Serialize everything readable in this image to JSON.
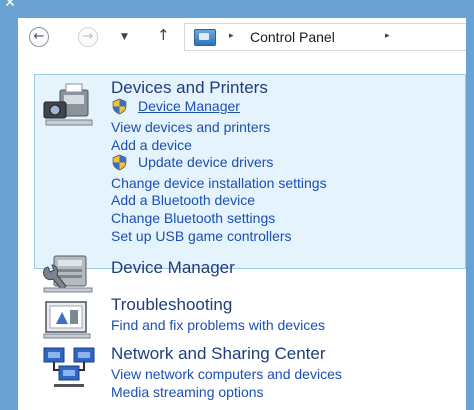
{
  "titlebar": {
    "close_glyph": "✕"
  },
  "nav": {
    "back_glyph": "←",
    "forward_glyph": "→",
    "dropdown_glyph": "▼",
    "up_glyph": "↑",
    "separator_glyph": "▸",
    "address": {
      "location": "Control Panel",
      "icon": "control-panel-icon"
    }
  },
  "sections": {
    "devices_printers": {
      "icon": "devices-printers-icon",
      "title": "Devices and Printers",
      "links": {
        "device_manager": "Device Manager",
        "view_devices": "View devices and printers",
        "add_device": "Add a device",
        "update_drivers": "Update device drivers",
        "installation_settings": "Change device installation settings",
        "add_bluetooth": "Add a Bluetooth device",
        "bluetooth_settings": "Change Bluetooth settings",
        "usb_game": "Set up USB game controllers"
      },
      "colors": {
        "highlight_bg": "#e5f3fc",
        "highlight_border": "#9ccbe9"
      }
    },
    "device_manager": {
      "icon": "device-manager-icon",
      "title": "Device Manager"
    },
    "troubleshooting": {
      "icon": "troubleshooting-icon",
      "title": "Troubleshooting",
      "links": {
        "fix_devices": "Find and fix problems with devices"
      }
    },
    "network": {
      "icon": "network-sharing-icon",
      "title": "Network and Sharing Center",
      "links": {
        "view_network": "View network computers and devices",
        "media_streaming": "Media streaming options"
      }
    }
  },
  "colors": {
    "frame": "#6aa2d4",
    "title_text": "#1e3d7a",
    "link_text": "#1a4fb3"
  }
}
